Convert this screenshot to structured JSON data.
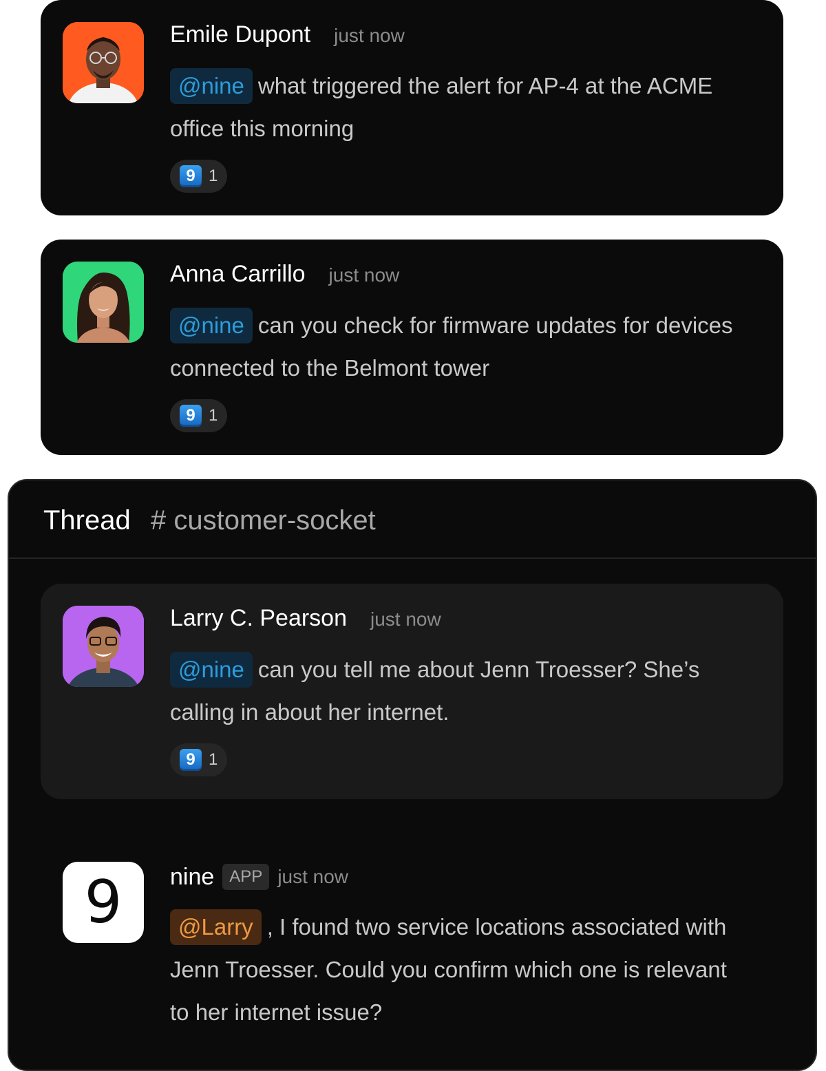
{
  "messages": [
    {
      "author": "Emile Dupont",
      "time": "just now",
      "mention": "@nine",
      "text": "what triggered the alert for AP-4 at the ACME office this morning",
      "reaction": {
        "emoji": "9",
        "count": "1"
      },
      "avatar_color": "#ff5a1f"
    },
    {
      "author": "Anna Carrillo",
      "time": "just now",
      "mention": "@nine",
      "text": "can you check for firmware updates for devices connected to the Belmont tower",
      "reaction": {
        "emoji": "9",
        "count": "1"
      },
      "avatar_color": "#2fd67a"
    }
  ],
  "thread": {
    "title": "Thread",
    "channel": "# customer-socket",
    "parent": {
      "author": "Larry C. Pearson",
      "time": "just now",
      "mention": "@nine",
      "text": "can you tell me about Jenn Troesser? She’s calling in about her internet.",
      "reaction": {
        "emoji": "9",
        "count": "1"
      },
      "avatar_color": "#b866f0"
    },
    "reply": {
      "avatar_glyph": "9",
      "author": "nine",
      "badge": "APP",
      "time": "just now",
      "mention": "@Larry",
      "text": ", I found two service locations associated with Jenn Troesser. Could you confirm which one is relevant to her internet issue?"
    }
  },
  "colors": {
    "background": "#0b0b0b",
    "mention_blue": "#2d9cdb",
    "mention_orange": "#ee9a45"
  }
}
